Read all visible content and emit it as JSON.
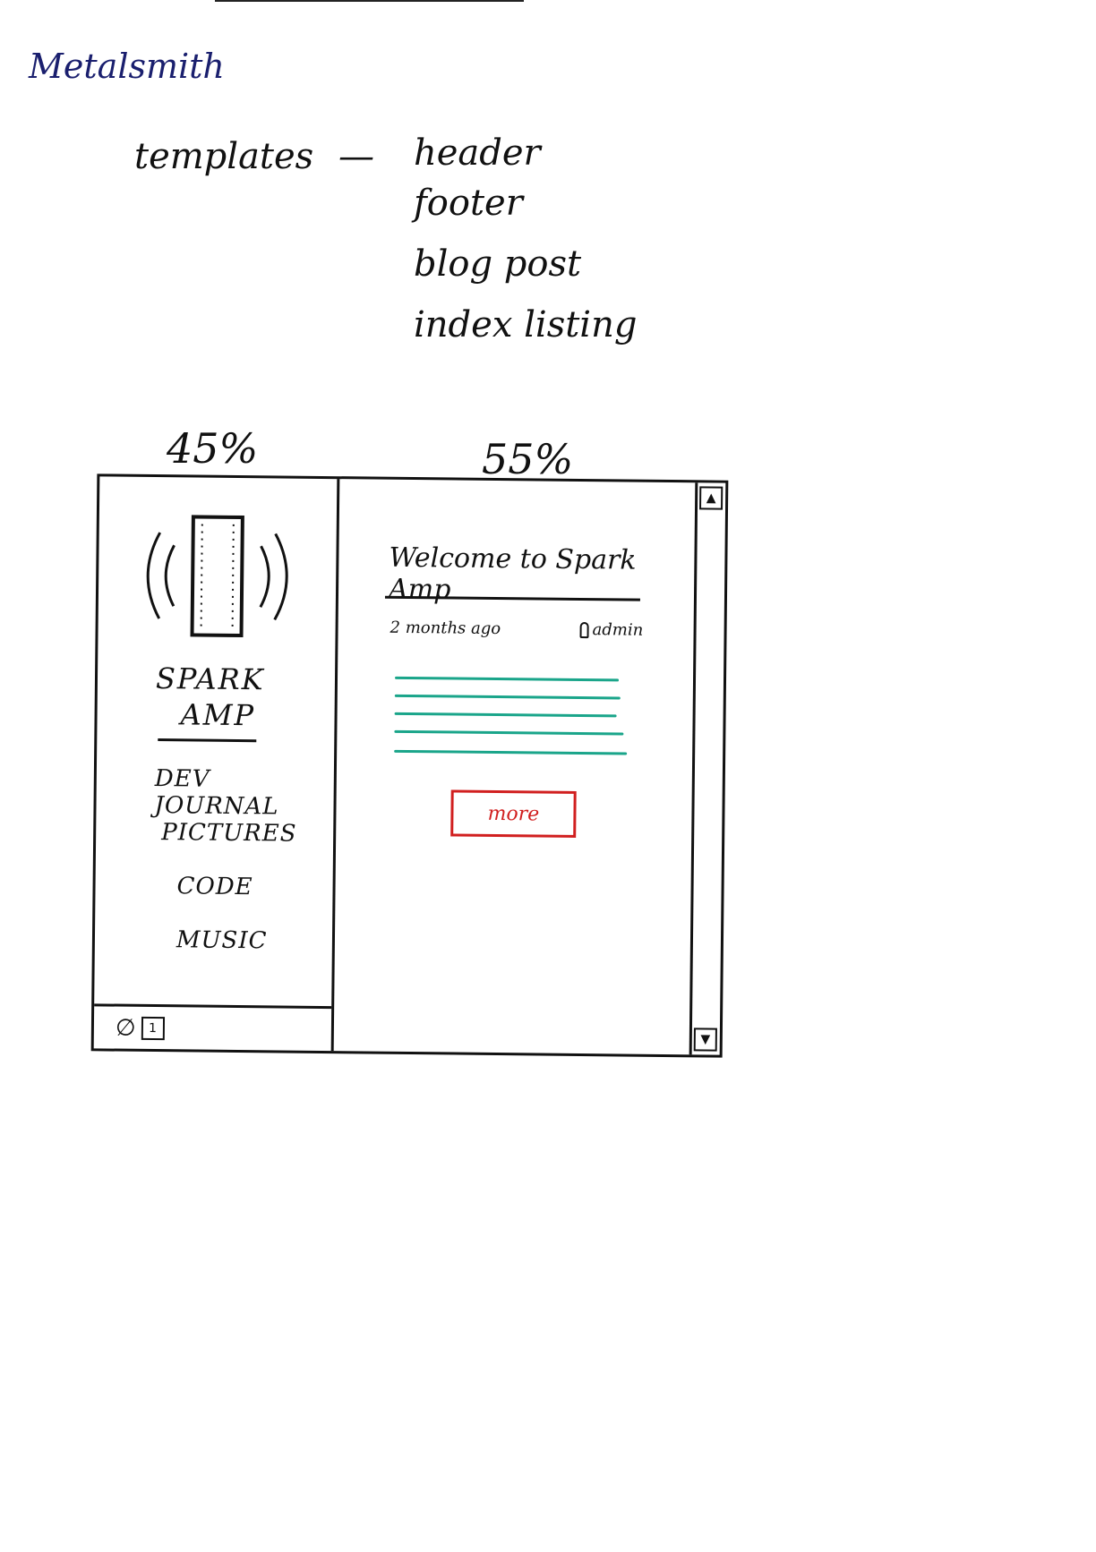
{
  "title": "Metalsmith",
  "notes": {
    "label": "templates",
    "dash": "—",
    "items": [
      "header",
      "footer",
      "blog post",
      "index listing"
    ]
  },
  "columns": {
    "left_width": "45%",
    "right_width": "55%"
  },
  "sidebar": {
    "brand_line1": "SPARK",
    "brand_line2": "AMP",
    "nav": [
      "DEV JOURNAL",
      "PICTURES",
      "CODE",
      "MUSIC"
    ],
    "footer_icon": "∅",
    "footer_badge": "1"
  },
  "post": {
    "title": "Welcome to Spark Amp",
    "time": "2 months ago",
    "author": "admin",
    "more_label": "more",
    "excerpt_color": "#1aa58a"
  },
  "scrollbar": {
    "up": "▲",
    "down": "▼"
  },
  "colors": {
    "title": "#1a1f6e",
    "ink": "#111111",
    "button": "#d11f1f"
  }
}
